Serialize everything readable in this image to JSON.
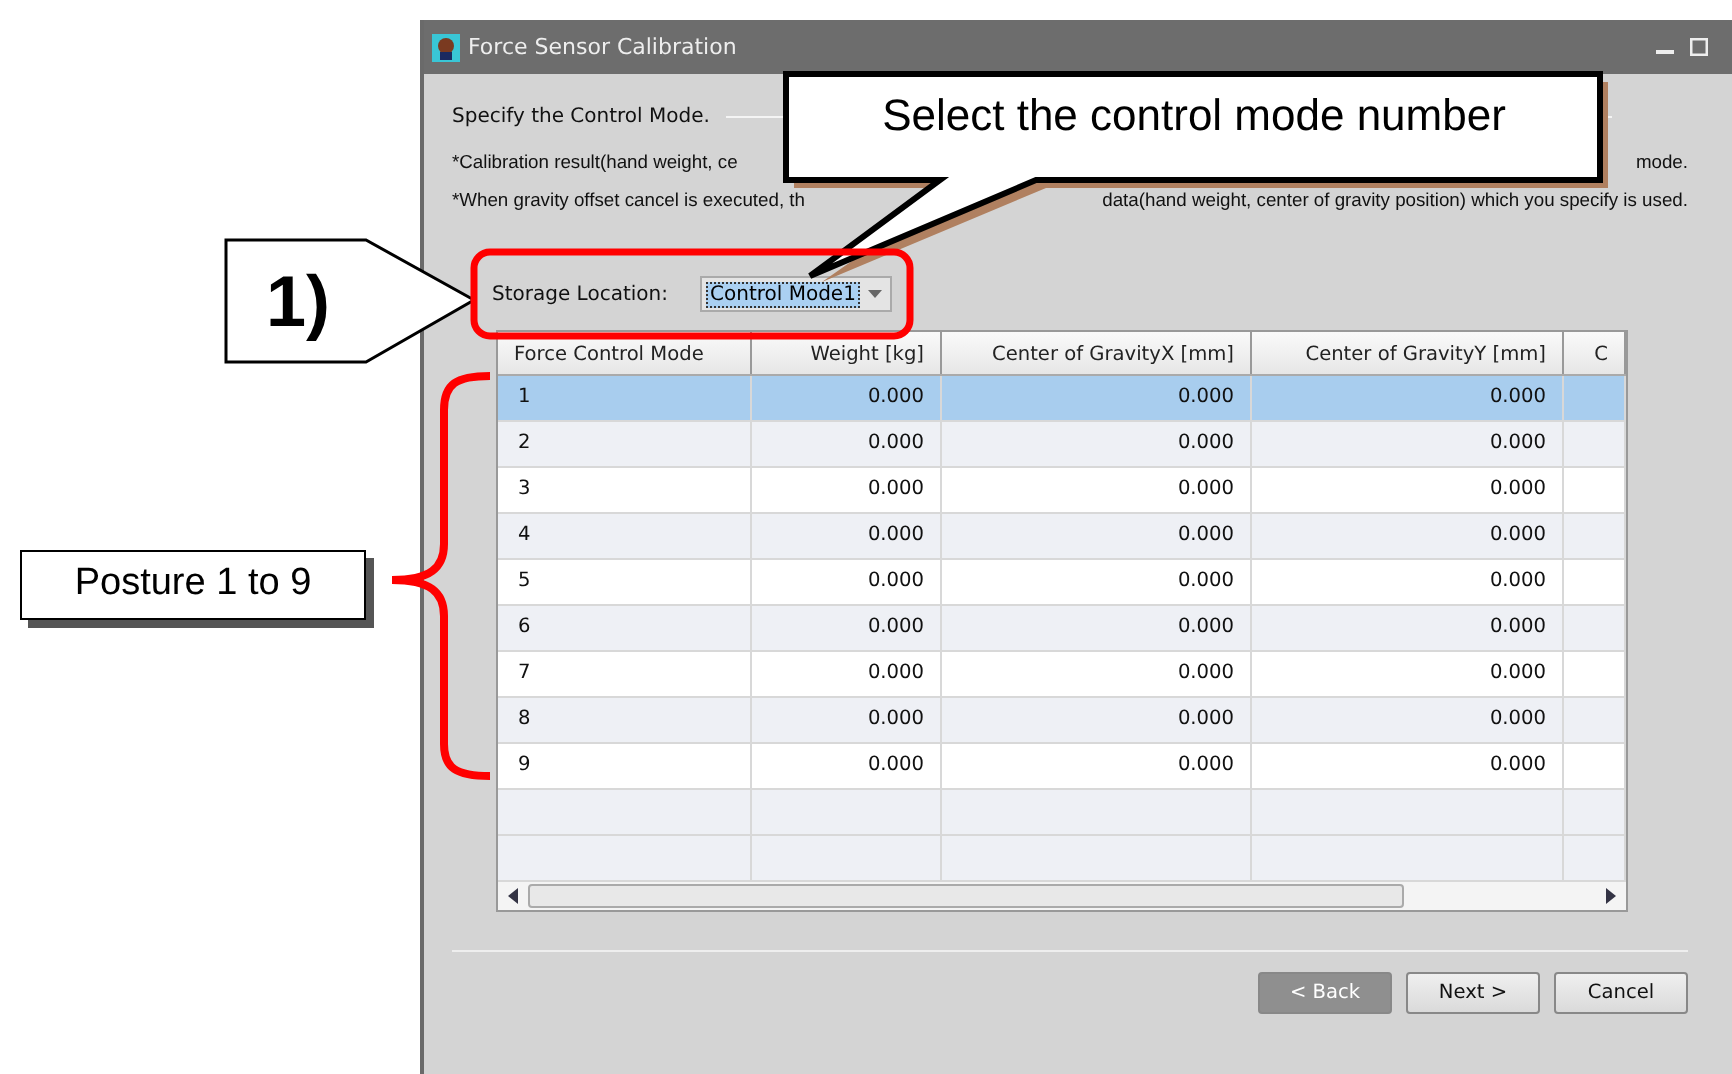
{
  "window": {
    "title": "Force Sensor Calibration"
  },
  "heading": "Specify the Control Mode.",
  "notes": [
    {
      "parts": [
        "*Calibration result(hand weight, ce",
        "mode."
      ]
    },
    {
      "parts": [
        "*When gravity offset cancel is executed, th",
        "data(hand weight, center of gravity position) which you specify is used."
      ]
    }
  ],
  "storage": {
    "label": "Storage Location:",
    "value": "Control Mode1"
  },
  "table": {
    "columns": [
      "Force Control Mode",
      "Weight  [kg]",
      "Center of GravityX  [mm]",
      "Center of GravityY  [mm]",
      "C"
    ],
    "rows": [
      {
        "cells": [
          "1",
          "0.000",
          "0.000",
          "0.000"
        ],
        "selected": true
      },
      {
        "cells": [
          "2",
          "0.000",
          "0.000",
          "0.000"
        ],
        "selected": false
      },
      {
        "cells": [
          "3",
          "0.000",
          "0.000",
          "0.000"
        ],
        "selected": false
      },
      {
        "cells": [
          "4",
          "0.000",
          "0.000",
          "0.000"
        ],
        "selected": false
      },
      {
        "cells": [
          "5",
          "0.000",
          "0.000",
          "0.000"
        ],
        "selected": false
      },
      {
        "cells": [
          "6",
          "0.000",
          "0.000",
          "0.000"
        ],
        "selected": false
      },
      {
        "cells": [
          "7",
          "0.000",
          "0.000",
          "0.000"
        ],
        "selected": false
      },
      {
        "cells": [
          "8",
          "0.000",
          "0.000",
          "0.000"
        ],
        "selected": false
      },
      {
        "cells": [
          "9",
          "0.000",
          "0.000",
          "0.000"
        ],
        "selected": false
      }
    ]
  },
  "buttons": [
    {
      "label": "< Back",
      "disabled": true
    },
    {
      "label": "Next >",
      "disabled": false
    },
    {
      "label": "Cancel",
      "disabled": false
    }
  ],
  "annotations": {
    "callout": "Select the control mode number",
    "step": "1)",
    "brace_label": "Posture 1 to 9"
  }
}
